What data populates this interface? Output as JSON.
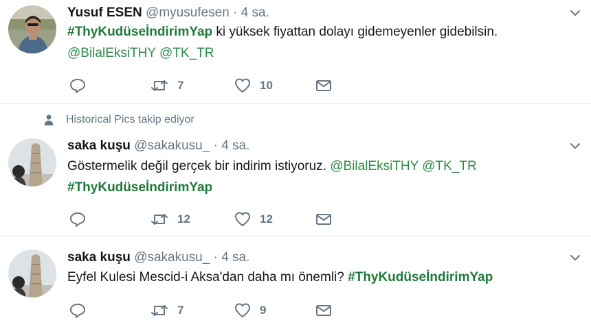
{
  "colors": {
    "hashtag": "#1f7a3a",
    "mention": "#2f8a4a",
    "meta": "#657786"
  },
  "tweets": [
    {
      "name": "Yusuf ESEN",
      "handle": "@myusufesen",
      "sep": "·",
      "time": "4 sa.",
      "line1": {
        "hashtag": "#ThyKudüseİndirimYap",
        "text": " ki yüksek fiyattan dolayı gidemeyenler gidebilsin."
      },
      "line2": {
        "mention1": "@BilalEksiTHY",
        "mention2": "@TK_TR"
      },
      "retweets": "7",
      "likes": "10"
    },
    {
      "context": "Historical Pics takip ediyor",
      "name": "saka kuşu",
      "handle": "@sakakusu_",
      "sep": "·",
      "time": "4 sa.",
      "line1": {
        "text": "Göstermelik değil gerçek bir indirim istiyoruz. ",
        "mention1": "@BilalEksiTHY",
        "mention2": "@TK_TR"
      },
      "line2": {
        "hashtag": "#ThyKudüseİndirimYap"
      },
      "retweets": "12",
      "likes": "12"
    },
    {
      "name": "saka kuşu",
      "handle": "@sakakusu_",
      "sep": "·",
      "time": "4 sa.",
      "line1": {
        "text": "Eyfel Kulesi Mescid-i Aksa'dan daha mı önemli? ",
        "hashtag": "#ThyKudüseİndirimYap"
      },
      "retweets": "7",
      "likes": "9"
    }
  ]
}
